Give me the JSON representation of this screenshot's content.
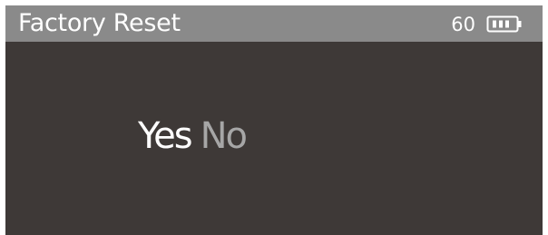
{
  "header": {
    "title": "Factory Reset",
    "value": "60",
    "battery_icon": "battery-icon"
  },
  "dialog": {
    "options": [
      {
        "label": "Yes",
        "selected": true
      },
      {
        "label": "No",
        "selected": false
      }
    ]
  },
  "colors": {
    "screen_background": "#3e3937",
    "header_background": "#8a8a8a",
    "selected_text": "#ffffff",
    "unselected_text": "#a6a6a6"
  }
}
